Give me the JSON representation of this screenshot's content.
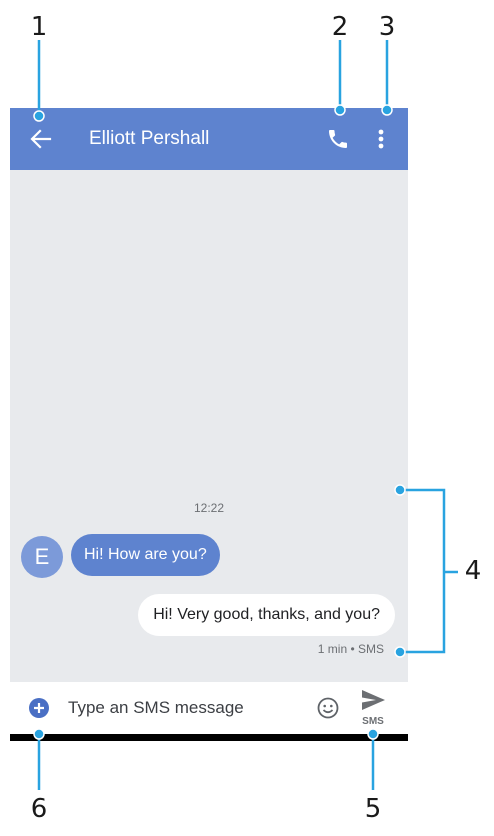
{
  "callouts": {
    "c1": "1",
    "c2": "2",
    "c3": "3",
    "c4": "4",
    "c5": "5",
    "c6": "6"
  },
  "toolbar": {
    "title": "Elliott Pershall",
    "back_icon": "arrow-left-icon",
    "call_icon": "phone-icon",
    "menu_icon": "more-vert-icon"
  },
  "conversation": {
    "timestamp": "12:22",
    "avatar_initial": "E",
    "incoming_message": "Hi! How are you?",
    "outgoing_message": "Hi! Very good, thanks, and you?",
    "outgoing_meta": "1 min • SMS"
  },
  "composer": {
    "placeholder": "Type an SMS message",
    "add_icon": "add-circle-icon",
    "emoji_icon": "emoji-icon",
    "send_icon": "send-icon",
    "send_label": "SMS"
  },
  "colors": {
    "accent": "#5e83cf",
    "callout": "#29a3e0",
    "conversation_bg": "#e8eaed"
  }
}
